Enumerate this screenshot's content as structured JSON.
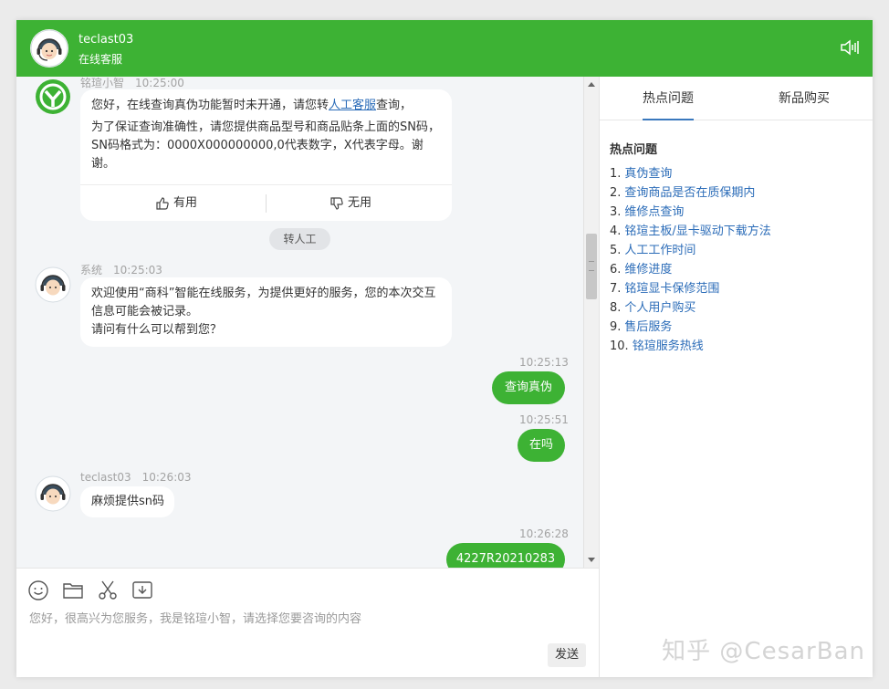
{
  "header": {
    "title": "teclast03",
    "subtitle": "在线客服",
    "icons": {
      "avatar": "agent-avatar-icon",
      "sound": "speaker-icon"
    }
  },
  "messages": {
    "bot1": {
      "sender": "铭瑄小智",
      "time": "10:25:00",
      "text_before_link": "您好，在线查询真伪功能暂时未开通，请您转",
      "link": "人工客服",
      "text_after_link": "查询，",
      "text2": "为了保证查询准确性，请您提供商品型号和商品贴条上面的SN码，SN码格式为：0000X000000000,0代表数字，X代表字母。谢谢。",
      "useful_label": "有用",
      "useless_label": "无用"
    },
    "transfer_label": "转人工",
    "system": {
      "sender": "系统",
      "time": "10:25:03",
      "line1": "欢迎使用“商科”智能在线服务，为提供更好的服务，您的本次交互信息可能会被记录。",
      "line2": "请问有什么可以帮到您？"
    },
    "user1": {
      "time": "10:25:13",
      "text": "查询真伪"
    },
    "user2": {
      "time": "10:25:51",
      "text": "在吗"
    },
    "agent": {
      "sender": "teclast03",
      "time": "10:26:03",
      "text": "麻烦提供sn码"
    },
    "user3": {
      "time": "10:26:28",
      "text": "4227R20210283"
    }
  },
  "input": {
    "placeholder": "您好，很高兴为您服务，我是铭瑄小智，请选择您要咨询的内容",
    "send_label": "发送",
    "tools": [
      "emoji-icon",
      "folder-icon",
      "scissors-icon",
      "download-icon"
    ]
  },
  "sidebar": {
    "tabs": [
      {
        "label": "热点问题",
        "active": true
      },
      {
        "label": "新品购买",
        "active": false
      }
    ],
    "hot_title": "热点问题",
    "items": [
      {
        "n": "1.",
        "q": "真伪查询"
      },
      {
        "n": "2.",
        "q": "查询商品是否在质保期内"
      },
      {
        "n": "3.",
        "q": "维修点查询"
      },
      {
        "n": "4.",
        "q": "铭瑄主板/显卡驱动下载方法"
      },
      {
        "n": "5.",
        "q": "人工工作时间"
      },
      {
        "n": "6.",
        "q": "维修进度"
      },
      {
        "n": "7.",
        "q": "铭瑄显卡保修范围"
      },
      {
        "n": "8.",
        "q": "个人用户购买"
      },
      {
        "n": "9.",
        "q": "售后服务"
      },
      {
        "n": "10.",
        "q": "铭瑄服务热线"
      }
    ]
  },
  "watermark": "知乎 @CesarBan",
  "colors": {
    "brand": "#3db234",
    "link": "#2b6cb8"
  }
}
